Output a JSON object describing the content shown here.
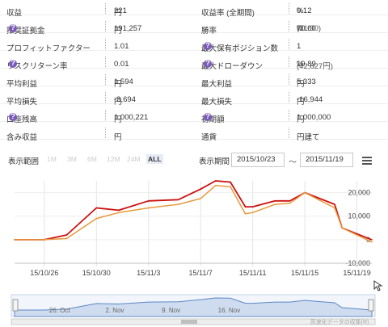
{
  "stats": [
    {
      "k1": "収益",
      "v1": "221",
      "u1": "円",
      "s1": "",
      "h1": false,
      "k2": "収益率 (全期間)",
      "v2": "0.12",
      "u2": "%",
      "s2": "",
      "h2": false
    },
    {
      "k1": "推奨証拠金",
      "v1": "191,257",
      "u1": "円",
      "s1": "",
      "h1": true,
      "k2": "勝率",
      "v2": "70.00",
      "u2": "%",
      "s2": "(21/30)",
      "h2": false
    },
    {
      "k1": "プロフィットファクター",
      "v1": "1.01",
      "u1": "",
      "s1": "",
      "h1": false,
      "k2": "最大保有ポジション数",
      "v2": "1",
      "u2": "",
      "s2": "",
      "h2": true
    },
    {
      "k1": "リスクリターン率",
      "v1": "0.01",
      "u1": "",
      "s1": "",
      "h1": true,
      "k2": "最大ドローダウン",
      "v2": "19.89",
      "u2": "%",
      "s2": "(42,827円)",
      "h2": true
    },
    {
      "k1": "平均利益",
      "v1": "1,594",
      "u1": "円",
      "s1": "",
      "h1": false,
      "k2": "最大利益",
      "v2": "5,333",
      "u2": "円",
      "s2": "",
      "h2": false
    },
    {
      "k1": "平均損失",
      "v1": "-3,694",
      "u1": "円",
      "s1": "",
      "h1": false,
      "k2": "最大損失",
      "v2": "-16,944",
      "u2": "円",
      "s2": "",
      "h2": false
    },
    {
      "k1": "口座残高",
      "v1": "1,000,221",
      "u1": "円",
      "s1": "",
      "h1": true,
      "k2": "初期額",
      "v2": "1,000,000",
      "u2": "円",
      "s2": "",
      "h2": true
    },
    {
      "k1": "含み収益",
      "v1": "-",
      "u1": "円",
      "s1": "",
      "h1": false,
      "k2": "通貨",
      "v2": "円建て",
      "u2": "",
      "s2": "",
      "h2": false
    }
  ],
  "toolbar": {
    "range_label": "表示範囲",
    "ranges": [
      "1M",
      "3M",
      "6M",
      "12M",
      "24M",
      "ALL"
    ],
    "active_range": "ALL",
    "period_label": "表示期間",
    "date_from": "2015/10/23",
    "tilde": "〜",
    "date_to": "2015/11/19"
  },
  "chart_data": {
    "type": "line",
    "ylim": [
      -10000,
      25000
    ],
    "yticks": [
      20000,
      10000,
      0,
      -10000
    ],
    "ytick_labels": [
      "20,000",
      "10,000",
      "0",
      "-10,000"
    ],
    "x_labels": [
      "15/10/26",
      "15/10/30",
      "15/11/3",
      "15/11/7",
      "15/11/11",
      "15/11/15",
      "15/11/19"
    ],
    "x_label_index": [
      4,
      11,
      18,
      25,
      32,
      39,
      46
    ],
    "n_points": 49,
    "series": [
      {
        "color": "#cc1111",
        "x": [
          0,
          4,
          7,
          11,
          14,
          18,
          22,
          25,
          27,
          29,
          31,
          32,
          35,
          37,
          39,
          43,
          44,
          48
        ],
        "y": [
          0,
          0,
          2000,
          13500,
          12500,
          16500,
          17000,
          21500,
          25000,
          24500,
          14000,
          14000,
          16500,
          16500,
          20000,
          15000,
          5000,
          0
        ]
      },
      {
        "color": "#e89a3c",
        "x": [
          0,
          4,
          7,
          11,
          14,
          18,
          22,
          25,
          27,
          29,
          31,
          32,
          35,
          37,
          39,
          43,
          44,
          48
        ],
        "y": [
          0,
          0,
          500,
          9000,
          11500,
          13500,
          15000,
          17500,
          23000,
          22500,
          11000,
          11500,
          15000,
          15500,
          20000,
          13500,
          5000,
          -1000
        ]
      }
    ],
    "navigator": {
      "labels": [
        "26. Oct",
        "2. Nov",
        "9. Nov",
        "16. Nov"
      ],
      "label_index": [
        4,
        11,
        18,
        25
      ],
      "footer_text": "高速化データの収集(R)"
    }
  }
}
